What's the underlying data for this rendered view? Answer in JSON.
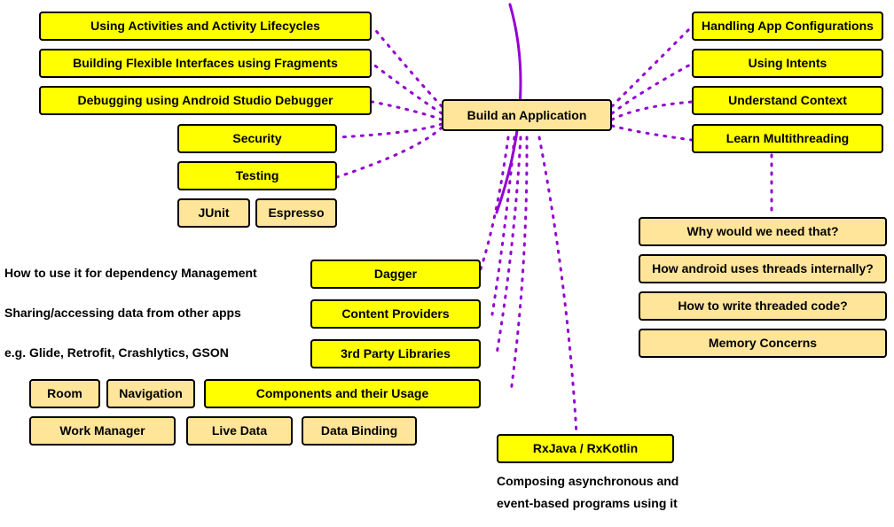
{
  "center": "Build an Application",
  "left_top": [
    "Using Activities and Activity Lifecycles",
    "Building Flexible Interfaces using Fragments",
    "Debugging using Android Studio Debugger",
    "Security",
    "Testing"
  ],
  "testing_children": [
    "JUnit",
    "Espresso"
  ],
  "right_top": [
    "Handling App Configurations",
    "Using Intents",
    "Understand Context",
    "Learn Multithreading"
  ],
  "thread_notes": [
    "Why would we need that?",
    "How android uses threads internally?",
    "How to write threaded code?",
    "Memory Concerns"
  ],
  "captions": [
    "How to use it for dependency Management",
    "Sharing/accessing data from other apps",
    "e.g. Glide, Retrofit, Crashlytics, GSON"
  ],
  "mid_stack": [
    "Dagger",
    "Content Providers",
    "3rd Party Libraries",
    "Components and their Usage"
  ],
  "components": [
    "Room",
    "Navigation",
    "Work Manager",
    "Live Data",
    "Data Binding"
  ],
  "rx": {
    "title": "RxJava / RxKotlin",
    "caption1": "Composing asynchronous and",
    "caption2": "event-based programs using it"
  }
}
